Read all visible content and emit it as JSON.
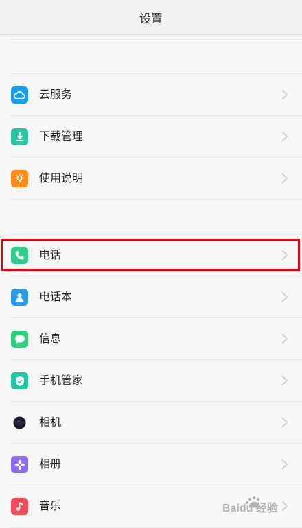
{
  "header": {
    "title": "设置"
  },
  "sections": [
    {
      "items": [
        {
          "label": "云服务",
          "icon": "cloud-icon",
          "color": "#1a9cf0"
        },
        {
          "label": "下载管理",
          "icon": "download-icon",
          "color": "#2ec4a6"
        },
        {
          "label": "使用说明",
          "icon": "lightbulb-icon",
          "color": "#ff8c1a"
        }
      ]
    },
    {
      "items": [
        {
          "label": "电话",
          "icon": "phone-icon",
          "color": "#2fce8a"
        },
        {
          "label": "电话本",
          "icon": "contacts-icon",
          "color": "#2c9be8"
        },
        {
          "label": "信息",
          "icon": "message-icon",
          "color": "#2fce7a"
        },
        {
          "label": "手机管家",
          "icon": "shield-icon",
          "color": "#22c6a6"
        },
        {
          "label": "相机",
          "icon": "camera-icon",
          "color": "#1c1c2e"
        },
        {
          "label": "相册",
          "icon": "gallery-icon",
          "color": "#8e6cf0"
        },
        {
          "label": "音乐",
          "icon": "music-icon",
          "color": "#f04c5a"
        }
      ]
    }
  ],
  "highlight_color": "#e00010",
  "watermark": {
    "text": "Baidu 经验"
  }
}
